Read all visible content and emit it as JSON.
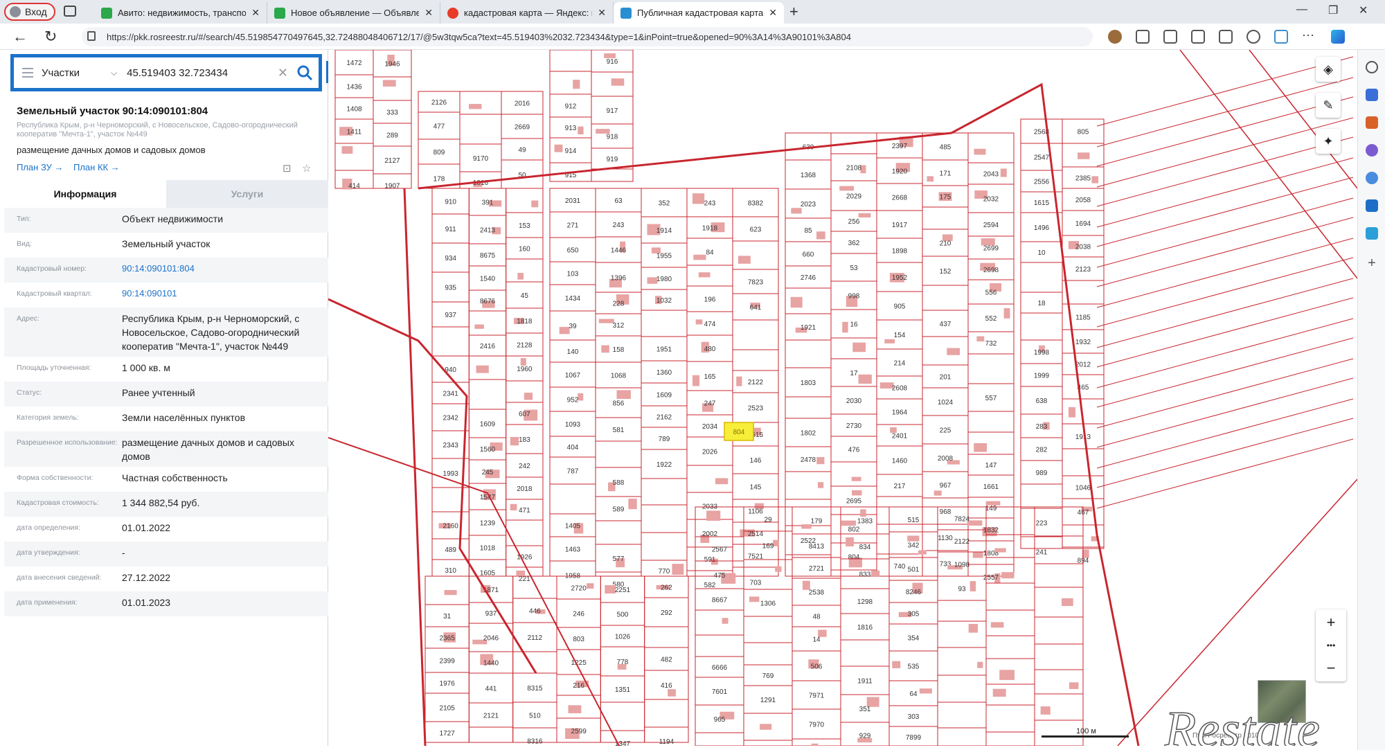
{
  "browser": {
    "profile_label": "Вход",
    "tabs": [
      {
        "title": "Авито: недвижимость, транспо",
        "icon_color": "#2aa84a"
      },
      {
        "title": "Новое объявление — Объявле",
        "icon_color": "#2aa84a"
      },
      {
        "title": "кадастровая карта — Яндекс: н",
        "icon_color": "#e83b2a"
      },
      {
        "title": "Публичная кадастровая карта",
        "icon_color": "#2a8fd1"
      }
    ],
    "url": "https://pkk.rosreestr.ru/#/search/45.519854770497645,32.72488048406712/17/@5w3tqw5ca?text=45.519403%2032.723434&type=1&inPoint=true&opened=90%3A14%3A90101%3A804"
  },
  "search": {
    "layer": "Участки",
    "query": "45.519403 32.723434"
  },
  "object": {
    "title": "Земельный участок 90:14:090101:804",
    "location": "Республика Крым, р-н Черноморский, с Новосельское, Садово-огороднический кооператив \"Мечта-1\", участок №449",
    "purpose": "размещение дачных домов и садовых домов",
    "plan_zu": "План ЗУ →",
    "plan_kk": "План КК →"
  },
  "panel_tabs": {
    "info": "Информация",
    "services": "Услуги"
  },
  "properties": [
    {
      "label": "Тип:",
      "value": "Объект недвижимости",
      "link": false
    },
    {
      "label": "Вид:",
      "value": "Земельный участок",
      "link": false
    },
    {
      "label": "Кадастровый номер:",
      "value": "90:14:090101:804",
      "link": true
    },
    {
      "label": "Кадастровый квартал:",
      "value": "90:14:090101",
      "link": true
    },
    {
      "label": "Адрес:",
      "value": "Республика Крым, р-н Черноморский, с Новосельское, Садово-огороднический кооператив \"Мечта-1\", участок №449",
      "link": false
    },
    {
      "label": "Площадь уточненная:",
      "value": "1 000 кв. м",
      "link": false
    },
    {
      "label": "Статус:",
      "value": "Ранее учтенный",
      "link": false
    },
    {
      "label": "Категория земель:",
      "value": "Земли населённых пунктов",
      "link": false
    },
    {
      "label": "Разрешенное использование:",
      "value": "размещение дачных домов и садовых домов",
      "link": false
    },
    {
      "label": "Форма собственности:",
      "value": "Частная собственность",
      "link": false
    },
    {
      "label": "Кадастровая стоимость:",
      "value": "1 344 882,54 руб.",
      "link": false
    },
    {
      "label": "дата определения:",
      "value": "01.01.2022",
      "link": false
    },
    {
      "label": "дата утверждения:",
      "value": "-",
      "link": false
    },
    {
      "label": "дата внесения сведений:",
      "value": "27.12.2022",
      "link": false
    },
    {
      "label": "дата применения:",
      "value": "01.01.2023",
      "link": false
    }
  ],
  "map": {
    "selected_parcel": "804",
    "scale_label": "100 м",
    "attribution": "Пу... Росреестр 2010",
    "watermark": "Restate",
    "colors": {
      "parcel_line": "#c8262f",
      "building_fill": "#e8a3a3",
      "selected_fill": "#f7ee3a",
      "accent": "#1c72c9"
    },
    "parcel_labels": [
      "1472",
      "1436",
      "1408",
      "1411",
      "414",
      "1946",
      "333",
      "289",
      "2127",
      "1907",
      "2126",
      "477",
      "809",
      "178",
      "9170",
      "1016",
      "2016",
      "2669",
      "49",
      "50",
      "912",
      "913",
      "914",
      "915",
      "916",
      "917",
      "918",
      "919",
      "910",
      "911",
      "934",
      "935",
      "937",
      "940",
      "2341",
      "2342",
      "2343",
      "1993",
      "2160",
      "489",
      "310",
      "391",
      "2413",
      "8675",
      "1540",
      "8676",
      "2416",
      "1609",
      "1560",
      "245",
      "1547",
      "1239",
      "1018",
      "1605",
      "153",
      "160",
      "45",
      "1818",
      "2128",
      "1960",
      "607",
      "183",
      "242",
      "2018",
      "471",
      "1926",
      "221",
      "2031",
      "271",
      "650",
      "103",
      "1434",
      "39",
      "140",
      "1067",
      "952",
      "1093",
      "404",
      "787",
      "1405",
      "1463",
      "1958",
      "63",
      "243",
      "1446",
      "1396",
      "228",
      "312",
      "158",
      "1068",
      "856",
      "581",
      "588",
      "589",
      "577",
      "580",
      "352",
      "1914",
      "1955",
      "1980",
      "1032",
      "1951",
      "1360",
      "1609",
      "2162",
      "789",
      "1922",
      "770",
      "243",
      "1918",
      "84",
      "196",
      "474",
      "480",
      "165",
      "247",
      "2034",
      "2026",
      "2033",
      "2002",
      "591",
      "582",
      "8382",
      "623",
      "7823",
      "641",
      "2122",
      "2523",
      "2515",
      "146",
      "145",
      "1106",
      "2514",
      "7521",
      "703",
      "630",
      "1368",
      "2023",
      "85",
      "660",
      "2746",
      "1921",
      "1803",
      "1802",
      "2478",
      "2522",
      "2108",
      "2029",
      "256",
      "362",
      "53",
      "998",
      "16",
      "17",
      "2030",
      "2730",
      "476",
      "2695",
      "802",
      "804",
      "2397",
      "1920",
      "2668",
      "1917",
      "1898",
      "1952",
      "905",
      "154",
      "214",
      "2608",
      "1964",
      "2401",
      "1460",
      "217",
      "740",
      "485",
      "171",
      "175",
      "210",
      "152",
      "437",
      "201",
      "1024",
      "225",
      "2008",
      "967",
      "968",
      "1130",
      "733",
      "2043",
      "2032",
      "2594",
      "2699",
      "2698",
      "556",
      "552",
      "732",
      "557",
      "147",
      "1661",
      "149",
      "1832",
      "1808",
      "2557",
      "2568",
      "2547",
      "2556",
      "1615",
      "1496",
      "10",
      "18",
      "1998",
      "1999",
      "638",
      "283",
      "282",
      "989",
      "223",
      "241",
      "805",
      "2385",
      "2058",
      "1694",
      "2038",
      "2123",
      "1185",
      "1932",
      "2012",
      "465",
      "1913",
      "1046",
      "467",
      "894",
      "31",
      "2365",
      "2399",
      "1976",
      "2105",
      "1727",
      "1871",
      "937",
      "2046",
      "1440",
      "441",
      "2121",
      "446",
      "2112",
      "8315",
      "510",
      "8316",
      "2720",
      "246",
      "803",
      "1225",
      "216",
      "2599",
      "2251",
      "500",
      "1026",
      "778",
      "1351",
      "1347",
      "262",
      "292",
      "482",
      "416",
      "1194",
      "2567",
      "475",
      "8667",
      "6666",
      "7601",
      "965",
      "29",
      "169",
      "1306",
      "769",
      "1291",
      "179",
      "8413",
      "2721",
      "2538",
      "48",
      "14",
      "506",
      "7971",
      "7970",
      "1383",
      "834",
      "833",
      "1298",
      "1816",
      "1911",
      "351",
      "929",
      "515",
      "342",
      "501",
      "8246",
      "305",
      "354",
      "535",
      "64",
      "303",
      "7899",
      "7824",
      "2122",
      "1098",
      "93"
    ]
  },
  "map_controls": {
    "zoom_in": "+",
    "zoom_dots": "•••",
    "zoom_out": "−"
  }
}
